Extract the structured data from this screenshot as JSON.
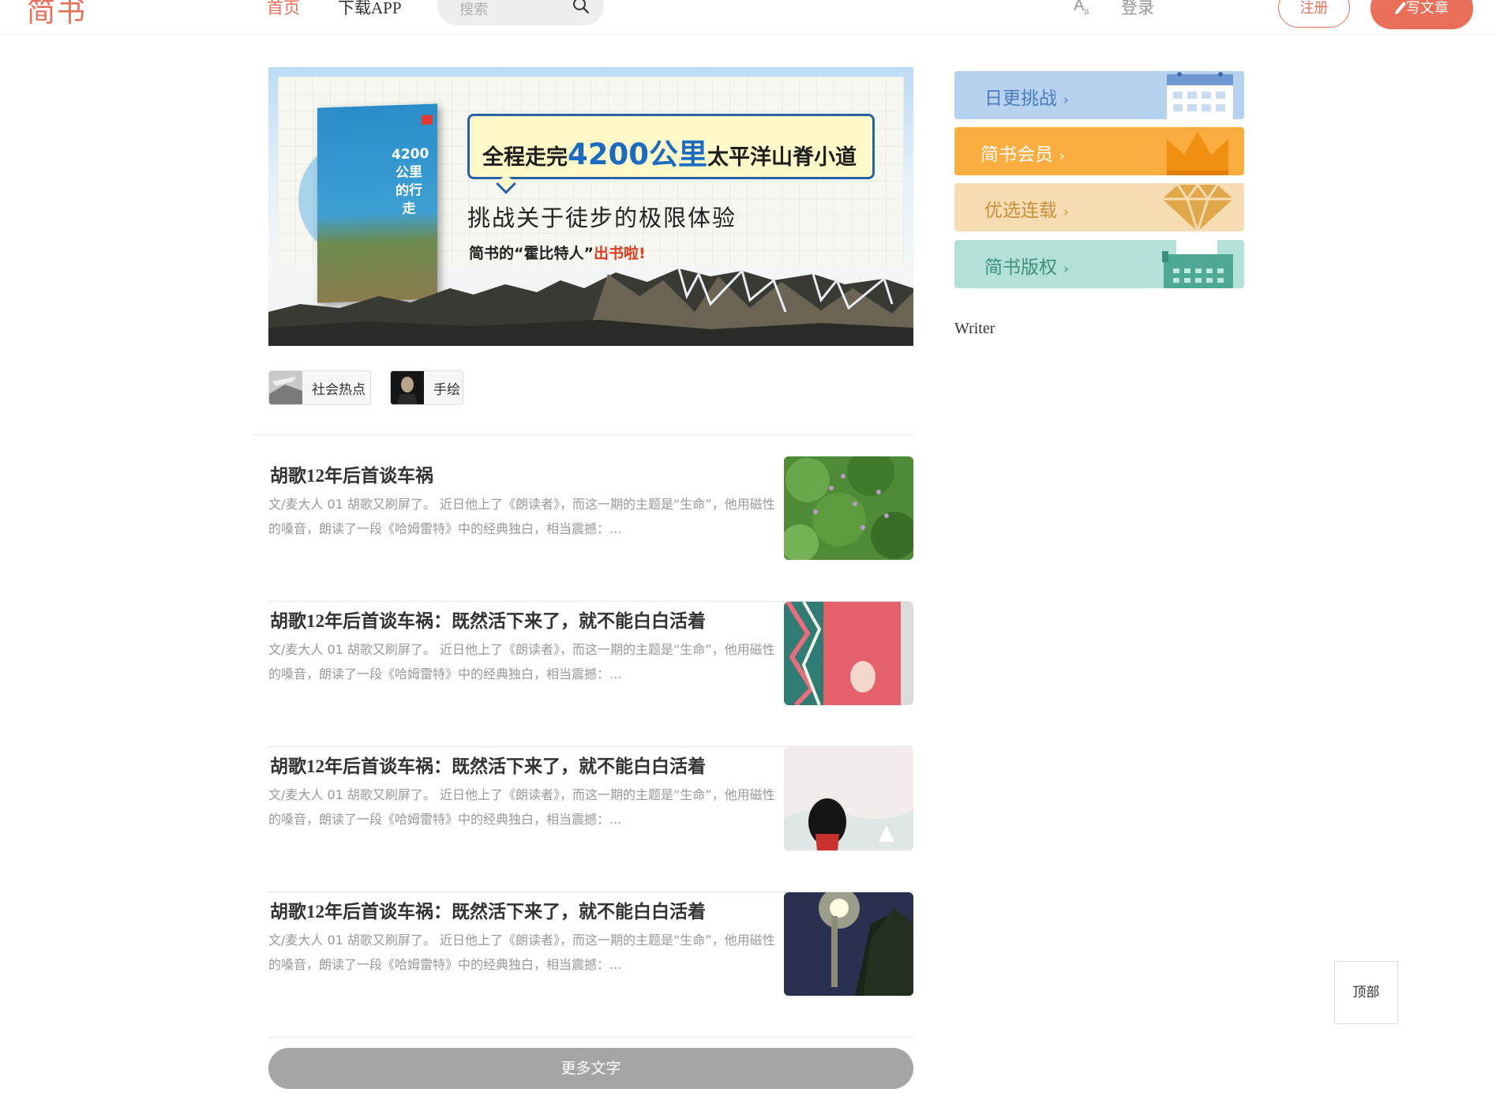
{
  "header": {
    "logo": "简书",
    "nav_home": "首页",
    "nav_app": "下载APP",
    "search_placeholder": "搜索",
    "font_toggle": "A",
    "font_toggle_sub": "a",
    "login": "登录",
    "register": "注册",
    "write": "写文章",
    "brand_color": "#ea6f5a"
  },
  "banner": {
    "book_title": "4200公里的行走",
    "bubble_prefix": "全程走完",
    "bubble_highlight": "4200公里",
    "bubble_suffix": "太平洋山脊小道",
    "subtitle": "挑战关于徒步的极限体验",
    "tagline_prefix": "简书的“霍比特人”",
    "tagline_highlight": "出书啦!"
  },
  "topics": [
    {
      "label": "社会热点"
    },
    {
      "label": "手绘"
    }
  ],
  "articles": [
    {
      "title": "胡歌12年后首谈车祸",
      "excerpt": "文/麦大人 01 胡歌又刷屏了。 近日他上了《朗读者》，而这一期的主题是“生命”，他用磁性的嗓音，朗读了一段《哈姆雷特》中的经典独白，相当震撼：..."
    },
    {
      "title": "胡歌12年后首谈车祸：既然活下来了，就不能白白活着",
      "excerpt": "文/麦大人 01 胡歌又刷屏了。 近日他上了《朗读者》，而这一期的主题是“生命”，他用磁性的嗓音，朗读了一段《哈姆雷特》中的经典独白，相当震撼：..."
    },
    {
      "title": "胡歌12年后首谈车祸：既然活下来了，就不能白白活着",
      "excerpt": "文/麦大人 01 胡歌又刷屏了。 近日他上了《朗读者》，而这一期的主题是“生命”，他用磁性的嗓音，朗读了一段《哈姆雷特》中的经典独白，相当震撼：..."
    },
    {
      "title": "胡歌12年后首谈车祸：既然活下来了，就不能白白活着",
      "excerpt": "文/麦大人 01 胡歌又刷屏了。 近日他上了《朗读者》，而这一期的主题是“生命”，他用磁性的嗓音，朗读了一段《哈姆雷特》中的经典独白，相当震撼：..."
    }
  ],
  "more_button": "更多文字",
  "sidebar": {
    "cards": [
      {
        "label": "日更挑战",
        "icon": "calendar-icon",
        "bg": "#b6d2ee",
        "color": "#4a7bbd"
      },
      {
        "label": "简书会员",
        "icon": "crown-icon",
        "bg": "#fbad3f",
        "color": "#ffffff"
      },
      {
        "label": "优选连载",
        "icon": "diamond-icon",
        "bg": "#f6dcb3",
        "color": "#c8903a"
      },
      {
        "label": "简书版权",
        "icon": "typewriter-icon",
        "bg": "#b3e1d7",
        "color": "#3f8f7c"
      }
    ],
    "chevron": "›",
    "writer": "Writer"
  },
  "back_to_top": "顶部"
}
